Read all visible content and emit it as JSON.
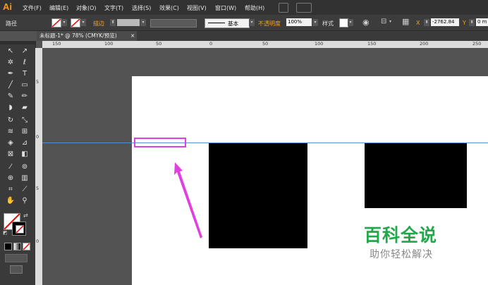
{
  "app": {
    "logo": "Ai"
  },
  "menu": [
    "文件(F)",
    "编辑(E)",
    "对象(O)",
    "文字(T)",
    "选择(S)",
    "效果(C)",
    "视图(V)",
    "窗口(W)",
    "帮助(H)"
  ],
  "control_bar": {
    "object_type": "路径",
    "stroke_label": "描边",
    "stroke_profile": "基本",
    "opacity_label": "不透明度",
    "opacity_value": "100%",
    "style_label": "样式",
    "x_label": "X",
    "x_value": "-2762.84",
    "y_label": "Y",
    "y_value": "0 m"
  },
  "document_tab": {
    "title": "未标题-1* @ 78% (CMYK/预览)",
    "close": "×"
  },
  "ruler": {
    "h_labels": [
      "150",
      "100",
      "50",
      "0",
      "50",
      "100",
      "150",
      "200",
      "250"
    ],
    "v_labels": [
      "5",
      "0",
      "5",
      "0"
    ]
  },
  "watermark": {
    "title": "百科全说",
    "subtitle": "助你轻松解决"
  },
  "colors": {
    "accent": "#ff9a00",
    "highlight": "#e040e0",
    "guide": "#5b8bd8",
    "watermark": "#21a84a"
  }
}
